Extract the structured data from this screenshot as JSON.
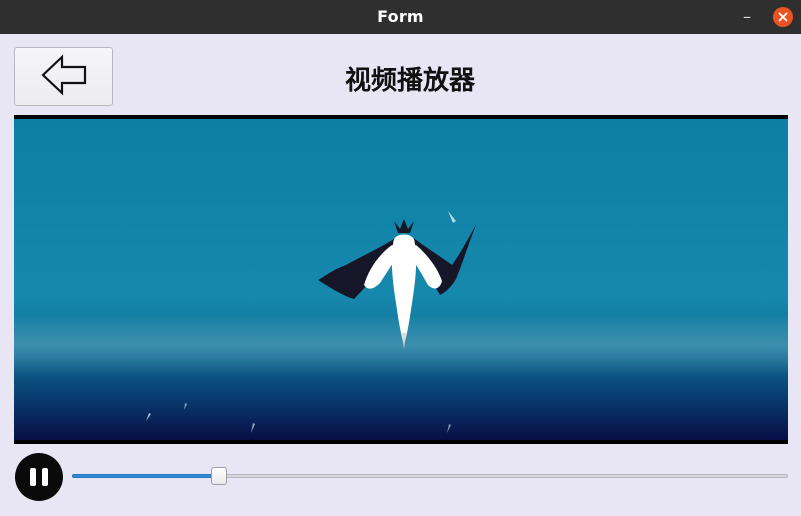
{
  "window": {
    "title": "Form",
    "minimize_icon": "minimize-icon",
    "close_icon": "close-icon",
    "close_color": "#e95420"
  },
  "toolbar": {
    "back_icon": "arrow-left-icon"
  },
  "header": {
    "title": "视频播放器"
  },
  "video": {
    "content": "seabird-diving-over-ocean"
  },
  "controls": {
    "play_pause_icon": "pause-icon",
    "state": "playing",
    "progress_fraction": 0.206,
    "accent": "#2f8ad6"
  }
}
